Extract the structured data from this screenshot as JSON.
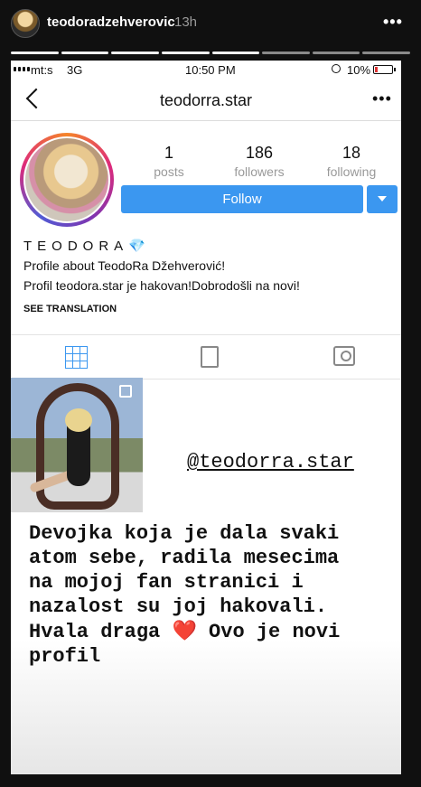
{
  "story": {
    "username": "teodoradzehverovic",
    "time": "13h",
    "menu": "•••",
    "segments_total": 8,
    "segments_done": 5
  },
  "status_bar": {
    "carrier": "mt:s",
    "network": "3G",
    "time": "10:50 PM",
    "battery": "10%"
  },
  "nav": {
    "title": "teodorra.star",
    "more": "•••"
  },
  "stats": [
    {
      "num": "1",
      "label": "posts"
    },
    {
      "num": "186",
      "label": "followers"
    },
    {
      "num": "18",
      "label": "following"
    }
  ],
  "follow_label": "Follow",
  "bio": {
    "name": "TEODORA",
    "gem": "💎",
    "line1": "Profile about TeodoRa Džehverović!",
    "line2": "Profil teodora.star je hakovan!Dobrodošli na novi!",
    "see_translation": "SEE TRANSLATION"
  },
  "overlay": {
    "handle": "@teodorra.star",
    "text_before": "Devojka koja je dala svaki\natom sebe, radila mesecima\nna mojoj fan stranici i\nnazalost su joj hakovali.\nHvala draga ",
    "heart": "❤️",
    "text_after": " Ovo je novi\nprofil"
  }
}
